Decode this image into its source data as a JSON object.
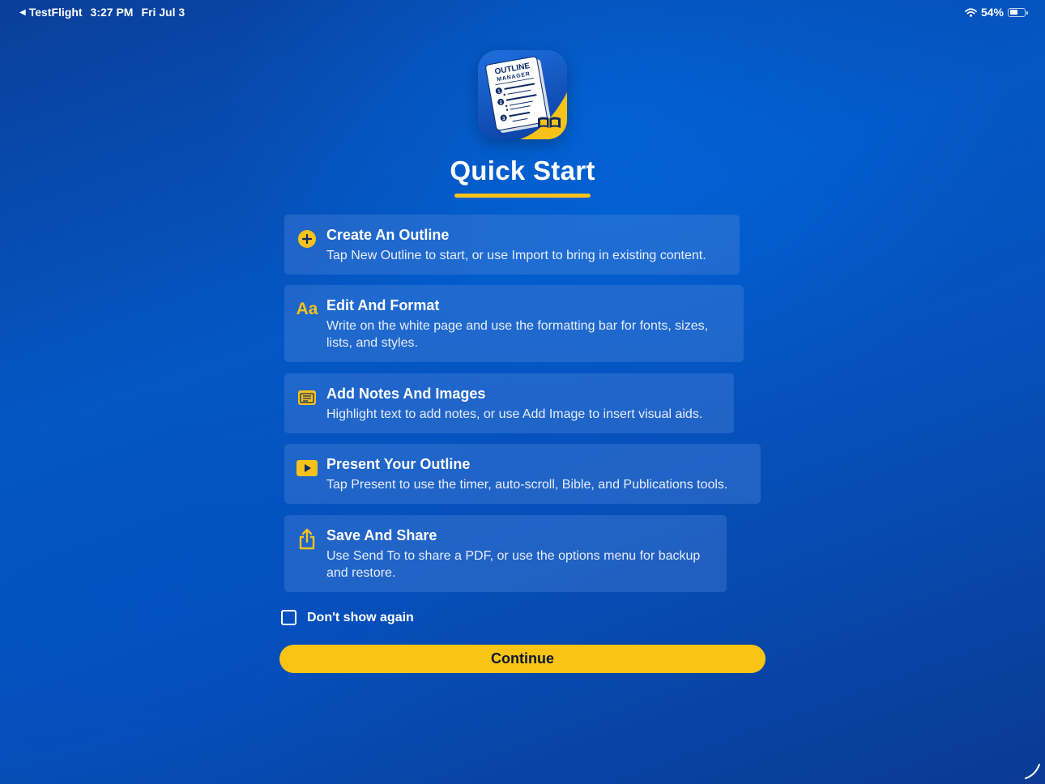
{
  "status_bar": {
    "back_app": "TestFlight",
    "time": "3:27 PM",
    "date": "Fri Jul 3",
    "battery_percent": "54%",
    "battery_level": 0.54,
    "back_icon": "triangle-left-icon",
    "wifi_icon": "wifi-icon"
  },
  "app_icon": {
    "line1": "OUTLINE",
    "line2": "MANAGER",
    "items": [
      "1",
      "2",
      "3"
    ]
  },
  "title": "Quick Start",
  "colors": {
    "accent": "#f6c21a",
    "button": "#f9c413",
    "button_text": "#0b1530",
    "background_start": "#0a3f9a",
    "background_mid": "#0457c5"
  },
  "cards": [
    {
      "icon": "plus-circle-icon",
      "title": "Create An Outline",
      "description": "Tap New Outline to start, or use Import to bring in existing content."
    },
    {
      "icon": "text-format-icon",
      "icon_text": "Aa",
      "title": "Edit And Format",
      "description": "Write on the white page and use the formatting bar for fonts, sizes, lists, and styles."
    },
    {
      "icon": "note-icon",
      "title": "Add Notes And Images",
      "description": "Highlight text to add notes, or use Add Image to insert visual aids."
    },
    {
      "icon": "play-icon",
      "title": "Present Your Outline",
      "description": "Tap Present to use the timer, auto-scroll, Bible, and Publications tools."
    },
    {
      "icon": "share-icon",
      "title": "Save And Share",
      "description": "Use Send To to share a PDF, or use the options menu for backup and restore."
    }
  ],
  "dont_show_again": {
    "label": "Don't show again",
    "checked": false
  },
  "continue_label": "Continue"
}
